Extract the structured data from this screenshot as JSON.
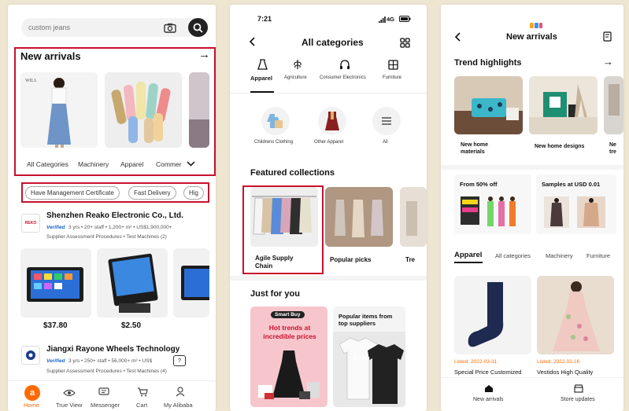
{
  "phone1": {
    "search": {
      "placeholder": "custom jeans"
    },
    "new_arrivals": {
      "title": "New arrivals",
      "arrow": "→"
    },
    "categories": [
      "All Categories",
      "Machinery",
      "Apparel",
      "Commer"
    ],
    "filter_chips": [
      "Have Management Certificate",
      "Fast Delivery",
      "Hig"
    ],
    "supplier1": {
      "logo": "REKO",
      "name": "Shenzhen Reako Electronic Co., Ltd.",
      "verified": "Verified",
      "meta": "3 yrs • 20+ staff • 1,200+ m² • US$1,900,000+",
      "tags": "Supplier Assessment Procedures • Test Machines (2)"
    },
    "prices": [
      "$37.80",
      "$2.50"
    ],
    "supplier2": {
      "name": "Jiangxi Rayone Wheels Technology",
      "verified": "Verified",
      "meta": "3 yrs • 250+ staff • 56,000+ m² • US$",
      "tags": "Supplier Assessment Procedures • Test Machines (4)"
    },
    "nav": [
      "Home",
      "True View",
      "Messenger",
      "Cart",
      "My Alibaba"
    ]
  },
  "phone2": {
    "time": "7:21",
    "signal": "4G",
    "title": "All categories",
    "tabs": [
      "Apparel",
      "Agriculture",
      "Consumer Electronics",
      "Furniture"
    ],
    "subcats": [
      "Childrens Clothing",
      "Other Apparel",
      "All"
    ],
    "featured": {
      "title": "Featured collections",
      "items": [
        "Agile Supply Chain",
        "Popular picks",
        "Tre"
      ]
    },
    "just_for_you": {
      "title": "Just for you",
      "badge": "Smart Buy",
      "promo": "Hot trends at incredible prices",
      "popular": "Popular items from top suppliers",
      "logo": "Logo"
    }
  },
  "phone3": {
    "title": "New arrivals",
    "trend": {
      "title": "Trend highlights",
      "arrow": "→",
      "items": [
        "New home materials",
        "New home designs",
        "Ne tre"
      ]
    },
    "deals": [
      "From 50% off",
      "Samples at USD 0.01"
    ],
    "tabs": [
      "Apparel",
      "All categories",
      "Machinery",
      "Furniture"
    ],
    "products": [
      {
        "listed": "Listed: 2022-03-31",
        "name": "Special Price Customized"
      },
      {
        "listed": "Listed: 2022-02-16",
        "name": "Vestidos High Quality"
      }
    ],
    "nav": [
      "New arrivals",
      "Store updates"
    ]
  },
  "colors": {
    "accent": "#ff6a00",
    "red_box": "#c8102e",
    "promo_pink": "#f7c6cc"
  }
}
